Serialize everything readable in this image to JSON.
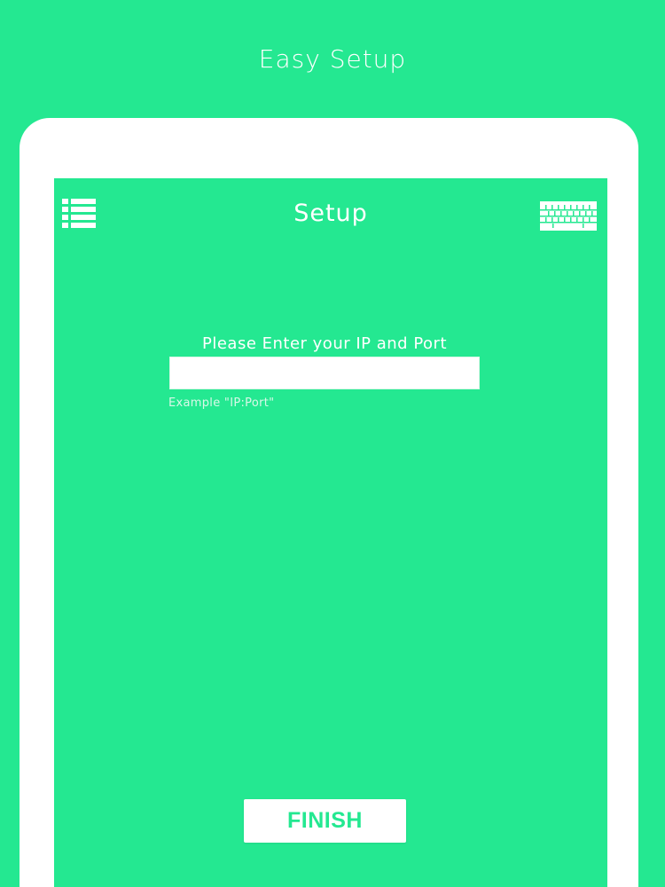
{
  "page": {
    "headline": "Easy Setup",
    "background_color": "#24e891"
  },
  "device": {
    "frame_color": "#ffffff"
  },
  "screen": {
    "nav": {
      "title": "Setup",
      "left_icon": "list-icon",
      "right_icon": "keyboard-icon"
    },
    "form": {
      "prompt": "Please Enter your IP and Port",
      "ip_value": "",
      "hint": "Example \"IP:Port\""
    },
    "finish_label": "FINISH",
    "accent_color": "#24e891"
  }
}
